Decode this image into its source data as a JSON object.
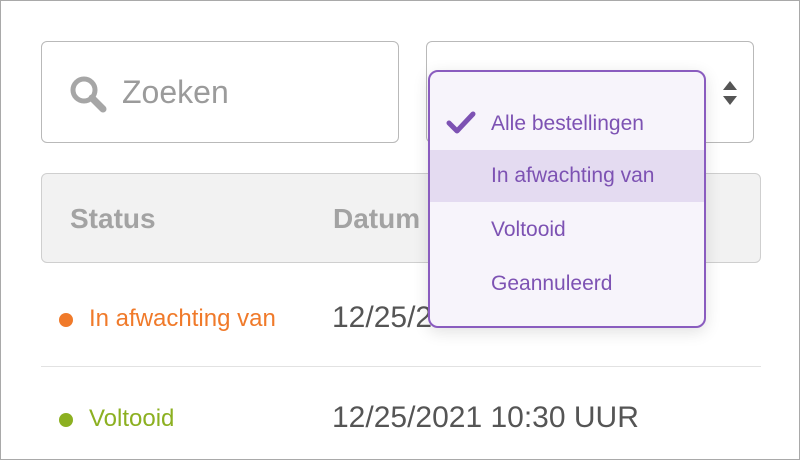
{
  "search": {
    "placeholder": "Zoeken",
    "icon": "search-icon"
  },
  "filter": {
    "arrows_icon": "sort-arrows-icon"
  },
  "table": {
    "headers": [
      "Status",
      "Datum"
    ],
    "rows": [
      {
        "status": "In afwachting van",
        "status_color": "#f07a2a",
        "date": "12/25/2021 10:30 UUR"
      },
      {
        "status": "Voltooid",
        "status_color": "#8cb021",
        "date": "12/25/2021 10:30 UUR"
      }
    ]
  },
  "dropdown": {
    "accent_color": "#7d52b3",
    "selected_index": 0,
    "highlighted_index": 1,
    "options": [
      {
        "label": "Alle bestellingen"
      },
      {
        "label": "In afwachting van"
      },
      {
        "label": "Voltooid"
      },
      {
        "label": "Geannuleerd"
      }
    ]
  }
}
